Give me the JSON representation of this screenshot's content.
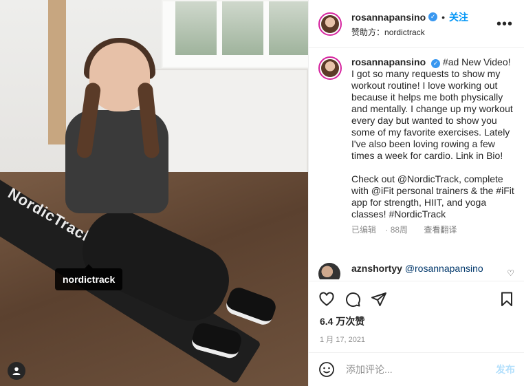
{
  "photo": {
    "brand_text": "NordicTrack",
    "tag_label": "nordictrack"
  },
  "header": {
    "username": "rosannapansino",
    "follow_label": "关注",
    "sponsor_prefix": "赞助方：",
    "sponsor_name": "nordictrack",
    "more_icon": "more-horizontal-icon"
  },
  "caption": {
    "username": "rosannapansino",
    "text": "#ad New Video! I got so many requests to show my workout routine! I love working out because it helps me both physically and mentally. I change up my workout every day but wanted to show you some of my favorite exercises. Lately I've also been loving rowing a few times a week for cardio. Link in Bio!",
    "text2": "Check out @NordicTrack, complete with @iFit personal trainers & the #iFit app for strength, HIIT, and yoga classes! #NordicTrack",
    "edited_label": "已编辑",
    "age": "88周",
    "translate_label": "查看翻译"
  },
  "comment": {
    "username": "aznshortyy",
    "text": "@rosannapansino"
  },
  "actions": {
    "likes": "6.4 万次赞",
    "date": "1 月 17, 2021"
  },
  "comment_box": {
    "placeholder": "添加评论...",
    "post_label": "发布"
  },
  "colors": {
    "accent": "#0095f6",
    "verified": "#3897f0",
    "post_disabled": "#b2dffc"
  }
}
